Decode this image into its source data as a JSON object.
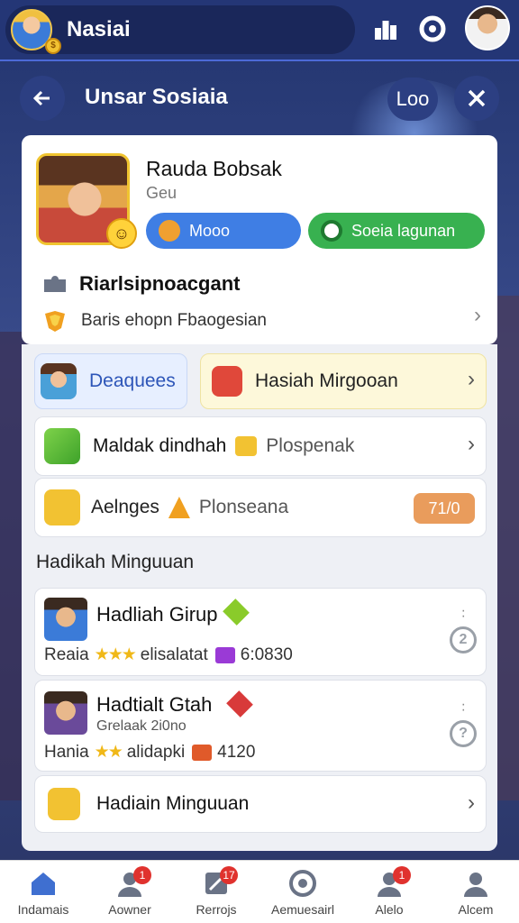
{
  "topbar": {
    "title": "Nasiai",
    "coin_icon": "coin-icon",
    "icons": [
      "podium-icon",
      "camera-icon"
    ]
  },
  "header": {
    "title": "Unsar Sosiaia",
    "right_label": "Loo"
  },
  "profile": {
    "name": "Rauda Bobsak",
    "sub": "Geu",
    "btn_blue": "Mooo",
    "btn_green": "Soeia lagunan",
    "row1": "Riarlsipnoacgant",
    "row2": "Baris ehopn Fbaogesian"
  },
  "tiles": {
    "blue_label": "Deaquees",
    "yellow_label": "Hasiah Mirgooan",
    "wide1_label": "Maldak dindhah",
    "wide1_sub": "Plospenak",
    "wide2_label": "Aelnges",
    "wide2_sub": "Plonseana",
    "wide2_badge": "71/0"
  },
  "section_title": "Hadikah Minguuan",
  "groups": [
    {
      "name": "Hadliah Girup",
      "line_prefix": "Reaia",
      "line_mid": "elisalatat",
      "line_value": "6:0830",
      "stars": "★★★"
    },
    {
      "name": "Hadtialt Gtah",
      "sub": "Grelaak 2i0no",
      "line_prefix": "Hania",
      "line_mid": "alidapki",
      "line_value": "4120",
      "stars": "★★"
    }
  ],
  "weekly": {
    "label": "Hadiain Minguuan"
  },
  "nav": [
    {
      "label": "Indamais",
      "badge": ""
    },
    {
      "label": "Aowner",
      "badge": "1"
    },
    {
      "label": "Rerrojs",
      "badge": "17"
    },
    {
      "label": "Aemuesairl",
      "badge": ""
    },
    {
      "label": "Alelo",
      "badge": "1"
    },
    {
      "label": "Alcem",
      "badge": ""
    }
  ],
  "colors": {
    "accent_blue": "#3f7ee4",
    "accent_green": "#38b150",
    "topbar": "#243676",
    "badge_red": "#e0322e"
  }
}
